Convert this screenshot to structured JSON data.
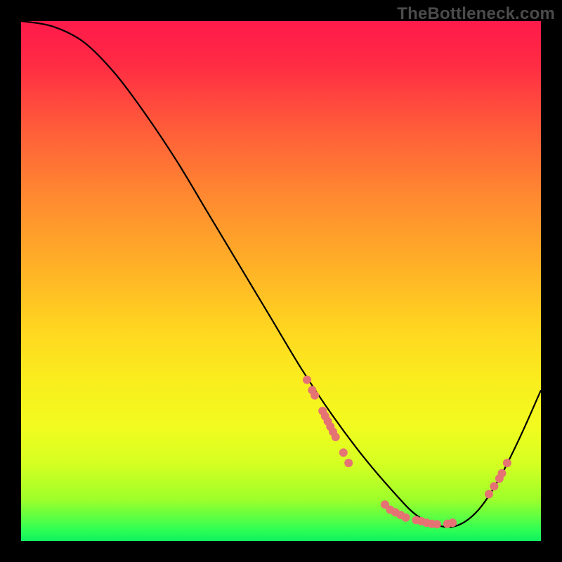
{
  "watermark": "TheBottleneck.com",
  "chart_data": {
    "type": "line",
    "title": "",
    "xlabel": "",
    "ylabel": "",
    "xlim": [
      0,
      100
    ],
    "ylim": [
      0,
      100
    ],
    "series": [
      {
        "name": "curve",
        "x": [
          0,
          6,
          12,
          18,
          24,
          30,
          36,
          42,
          48,
          54,
          60,
          66,
          72,
          76,
          80,
          84,
          88,
          92,
          96,
          100
        ],
        "y": [
          100,
          99,
          96,
          90,
          82,
          73,
          63,
          53,
          43,
          33,
          24,
          16,
          9,
          5,
          3,
          3,
          6,
          12,
          20,
          29
        ]
      }
    ],
    "markers": [
      {
        "x": 55,
        "y": 31
      },
      {
        "x": 56,
        "y": 29
      },
      {
        "x": 56.5,
        "y": 28
      },
      {
        "x": 58,
        "y": 25
      },
      {
        "x": 58.5,
        "y": 24
      },
      {
        "x": 59,
        "y": 23
      },
      {
        "x": 59.5,
        "y": 22
      },
      {
        "x": 60,
        "y": 21
      },
      {
        "x": 60.5,
        "y": 20
      },
      {
        "x": 62,
        "y": 17
      },
      {
        "x": 63,
        "y": 15
      },
      {
        "x": 70,
        "y": 7
      },
      {
        "x": 71,
        "y": 6
      },
      {
        "x": 72,
        "y": 5.5
      },
      {
        "x": 73,
        "y": 5
      },
      {
        "x": 74,
        "y": 4.5
      },
      {
        "x": 76,
        "y": 4
      },
      {
        "x": 77,
        "y": 3.8
      },
      {
        "x": 78,
        "y": 3.5
      },
      {
        "x": 79,
        "y": 3.3
      },
      {
        "x": 80,
        "y": 3.2
      },
      {
        "x": 82,
        "y": 3.3
      },
      {
        "x": 83,
        "y": 3.5
      },
      {
        "x": 90,
        "y": 9
      },
      {
        "x": 91,
        "y": 10.5
      },
      {
        "x": 92,
        "y": 12
      },
      {
        "x": 92.5,
        "y": 13
      },
      {
        "x": 93.5,
        "y": 15
      }
    ]
  }
}
